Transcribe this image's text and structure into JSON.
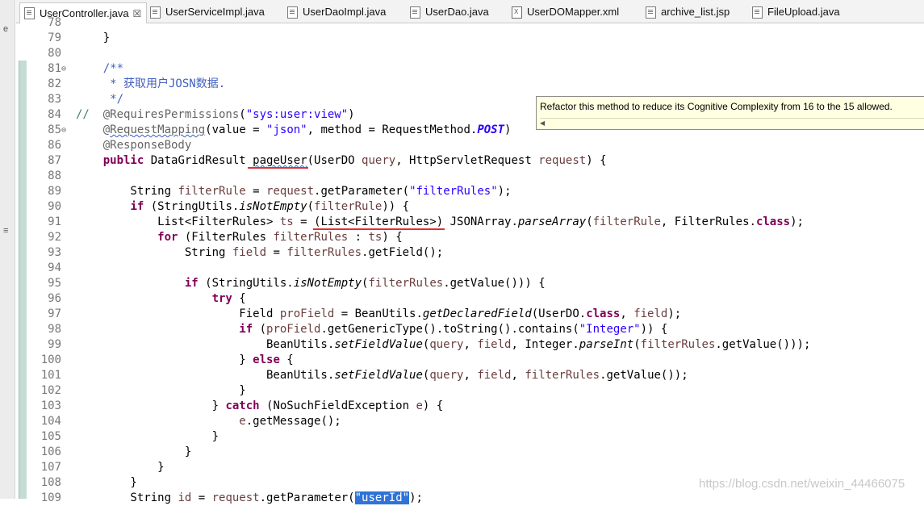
{
  "tabs": [
    {
      "label": "UserController.java",
      "active": true,
      "icon": "java-file-icon"
    },
    {
      "label": "UserServiceImpl.java",
      "active": false,
      "icon": "java-file-icon"
    },
    {
      "label": "UserDaoImpl.java",
      "active": false,
      "icon": "java-file-icon"
    },
    {
      "label": "UserDao.java",
      "active": false,
      "icon": "java-file-icon"
    },
    {
      "label": "UserDOMapper.xml",
      "active": false,
      "icon": "xml-file-icon"
    },
    {
      "label": "archive_list.jsp",
      "active": false,
      "icon": "jsp-file-icon"
    },
    {
      "label": "FileUpload.java",
      "active": false,
      "icon": "java-file-icon"
    }
  ],
  "tab_close_glyph": "☒",
  "side_labels": {
    "top": "e",
    "mid": "≡"
  },
  "editor": {
    "line_numbers": [
      "78",
      "79",
      "80",
      "81",
      "82",
      "83",
      "84",
      "85",
      "86",
      "87",
      "88",
      "89",
      "90",
      "91",
      "92",
      "93",
      "94",
      "95",
      "96",
      "97",
      "98",
      "99",
      "100",
      "101",
      "102",
      "103",
      "104",
      "105",
      "106",
      "107",
      "108",
      "109"
    ],
    "fold_glyph": "⊖",
    "lines": [
      "",
      "    }",
      "",
      "    /**",
      "     * 获取用户JOSN数据.",
      "     */",
      "//  @RequiresPermissions(\"sys:user:view\")",
      "    @RequestMapping(value = \"json\", method = RequestMethod.POST)",
      "    @ResponseBody",
      "    public DataGridResult pageUser(UserDO query, HttpServletRequest request) {",
      "",
      "        String filterRule = request.getParameter(\"filterRules\");",
      "        if (StringUtils.isNotEmpty(filterRule)) {",
      "            List<FilterRules> ts = (List<FilterRules>) JSONArray.parseArray(filterRule, FilterRules.class);",
      "            for (FilterRules filterRules : ts) {",
      "                String field = filterRules.getField();",
      "",
      "                if (StringUtils.isNotEmpty(filterRules.getValue())) {",
      "                    try {",
      "                        Field proField = BeanUtils.getDeclaredField(UserDO.class, field);",
      "                        if (proField.getGenericType().toString().contains(\"Integer\")) {",
      "                            BeanUtils.setFieldValue(query, field, Integer.parseInt(filterRules.getValue()));",
      "                        } else {",
      "                            BeanUtils.setFieldValue(query, field, filterRules.getValue());",
      "                        }",
      "                    } catch (NoSuchFieldException e) {",
      "                        e.getMessage();",
      "                    }",
      "                }",
      "            }",
      "        }",
      "        String id = request.getParameter(\"userId\");"
    ]
  },
  "tooltip": {
    "text": "Refactor this method to reduce its Cognitive Complexity from 16 to the 15 allowed."
  },
  "watermark": "https://blog.csdn.net/weixin_44466075",
  "colors": {
    "keyword": "#7f0055",
    "string": "#2a00ff",
    "javadoc": "#3f5fbf",
    "line_comment": "#3f7f5f",
    "annotation": "#646464",
    "parameter": "#6a3e3e",
    "selection": "#2f73d6",
    "issue_underline": "#e03030"
  }
}
